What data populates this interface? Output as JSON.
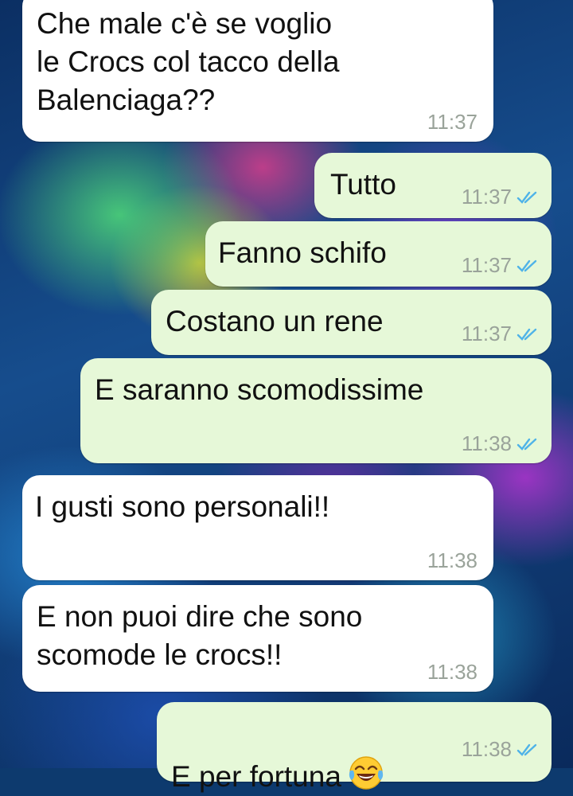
{
  "chat": {
    "messages": [
      {
        "direction": "incoming",
        "text": "Che male c'è se voglio\nle Crocs col tacco della\nBalenciaga??",
        "time": "11:37"
      },
      {
        "direction": "outgoing",
        "text": "Tutto",
        "time": "11:37",
        "status": "read-ticks-icon"
      },
      {
        "direction": "outgoing",
        "text": "Fanno schifo",
        "time": "11:37",
        "status": "read-ticks-icon"
      },
      {
        "direction": "outgoing",
        "text": "Costano un rene",
        "time": "11:37",
        "status": "read-ticks-icon"
      },
      {
        "direction": "outgoing",
        "text": "E saranno scomodissime",
        "time": "11:38",
        "status": "read-ticks-icon"
      },
      {
        "direction": "incoming",
        "text": "I gusti sono personali!!",
        "time": "11:38"
      },
      {
        "direction": "incoming",
        "text": "E non puoi dire che sono\nscomode le crocs!!",
        "time": "11:38"
      },
      {
        "direction": "outgoing",
        "text": "E per fortuna",
        "emoji": "tears-of-joy-emoji-icon",
        "time": "11:38",
        "status": "read-ticks-icon"
      }
    ]
  },
  "colors": {
    "incoming_bubble": "#ffffff",
    "outgoing_bubble": "#e6f8d8",
    "read_ticks": "#4fb3e8",
    "timestamp": "#9aa39a"
  }
}
